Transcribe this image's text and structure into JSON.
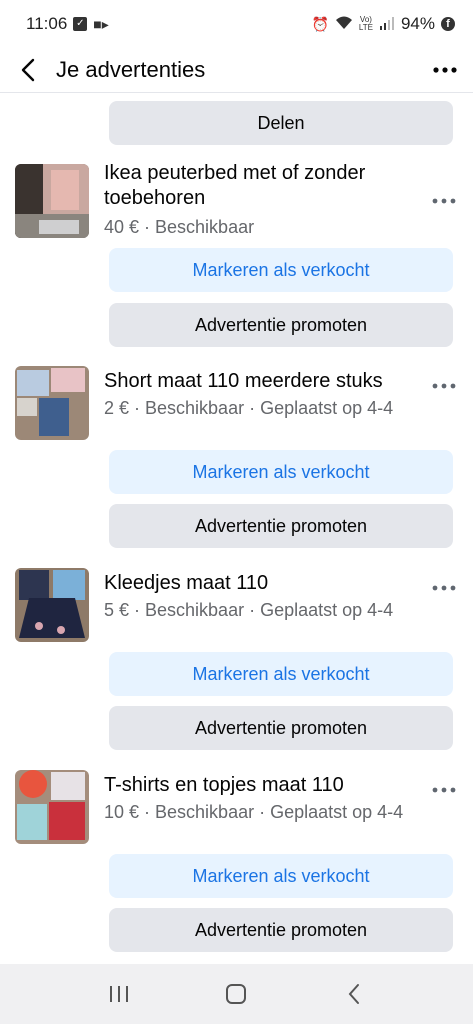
{
  "status": {
    "time": "11:06",
    "battery": "94%",
    "net_label": "Vo)\nLTE"
  },
  "header": {
    "title": "Je advertenties"
  },
  "top": {
    "share_label": "Delen"
  },
  "listings": [
    {
      "title": "Ikea peuterbed met of zonder toebehoren",
      "meta": "40 € · Beschikbaar",
      "mark_sold": "Markeren als verkocht",
      "promote": "Advertentie promoten"
    },
    {
      "title": "Short maat 110 meerdere stuks",
      "meta": "2 € · Beschikbaar · Geplaatst op 4-4",
      "mark_sold": "Markeren als verkocht",
      "promote": "Advertentie promoten"
    },
    {
      "title": "Kleedjes maat 110",
      "meta": "5 € · Beschikbaar · Geplaatst op 4-4",
      "mark_sold": "Markeren als verkocht",
      "promote": "Advertentie promoten"
    },
    {
      "title": "T-shirts en topjes maat 110",
      "meta": "10 € · Beschikbaar · Geplaatst op 4-4",
      "mark_sold": "Markeren als verkocht",
      "promote": "Advertentie promoten"
    }
  ],
  "colors": {
    "accent": "#1b74e4",
    "gray_button": "#e4e6eb",
    "blue_button": "#e7f3ff"
  }
}
